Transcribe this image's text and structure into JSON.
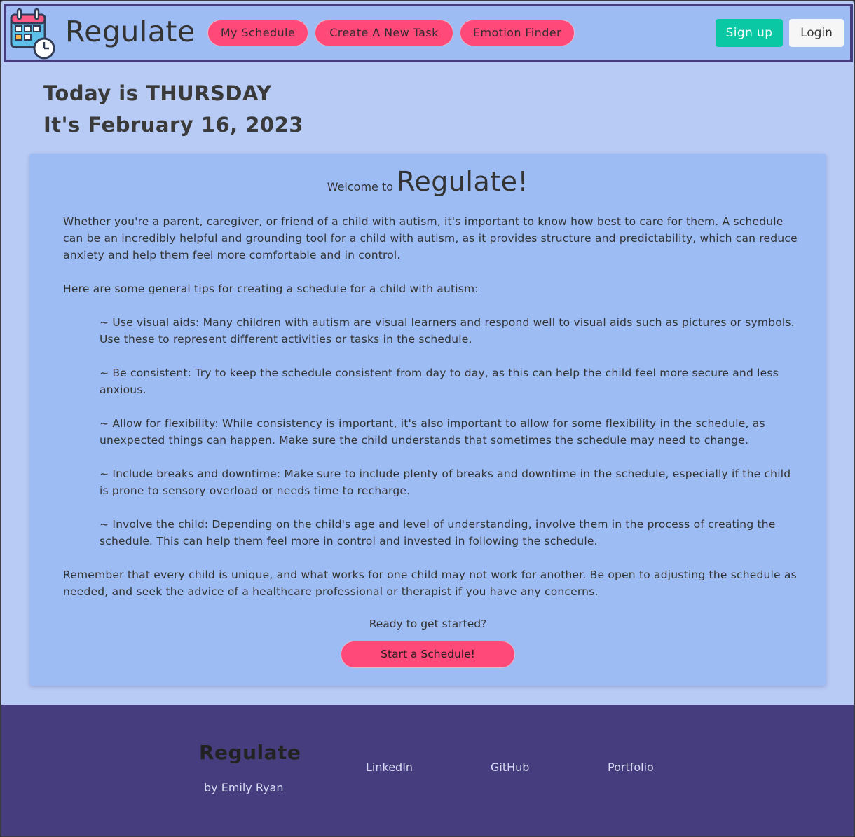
{
  "header": {
    "brand": "Regulate",
    "nav": [
      {
        "label": "My Schedule"
      },
      {
        "label": "Create A New Task"
      },
      {
        "label": "Emotion Finder"
      }
    ],
    "signup_label": "Sign up",
    "login_label": "Login"
  },
  "date": {
    "day_line": "Today is THURSDAY",
    "date_line": "It's February 16, 2023"
  },
  "welcome": {
    "prefix": "Welcome to",
    "title": "Regulate!",
    "intro": "Whether you're a parent, caregiver, or friend of a child with autism, it's important to know how best to care for them. A schedule can be an incredibly helpful and grounding tool for a child with autism, as it provides structure and predictability, which can reduce anxiety and help them feel more comfortable and in control.",
    "tips_intro": "Here are some general tips for creating a schedule for a child with autism:",
    "tips": [
      "~ Use visual aids: Many children with autism are visual learners and respond well to visual aids such as pictures or symbols. Use these to represent different activities or tasks in the schedule.",
      "~ Be consistent: Try to keep the schedule consistent from day to day, as this can help the child feel more secure and less anxious.",
      "~ Allow for flexibility: While consistency is important, it's also important to allow for some flexibility in the schedule, as unexpected things can happen. Make sure the child understands that sometimes the schedule may need to change.",
      "~ Include breaks and downtime: Make sure to include plenty of breaks and downtime in the schedule, especially if the child is prone to sensory overload or needs time to recharge.",
      "~ Involve the child: Depending on the child's age and level of understanding, involve them in the process of creating the schedule. This can help them feel more in control and invested in following the schedule."
    ],
    "closing": "Remember that every child is unique, and what works for one child may not work for another. Be open to adjusting the schedule as needed, and seek the advice of a healthcare professional or therapist if you have any concerns.",
    "ready": "Ready to get started?",
    "start_label": "Start a Schedule!"
  },
  "footer": {
    "title": "Regulate",
    "byline": "by Emily Ryan",
    "links": [
      {
        "label": "LinkedIn"
      },
      {
        "label": "GitHub"
      },
      {
        "label": "Portfolio"
      }
    ]
  },
  "colors": {
    "navbar": "#9dbcf3",
    "page_bg": "#b8cbf5",
    "accent_pink": "#ff4979",
    "signup_green": "#0bc8a5",
    "footer": "#463d7e"
  },
  "icons": {
    "logo": "calendar-clock-icon"
  }
}
